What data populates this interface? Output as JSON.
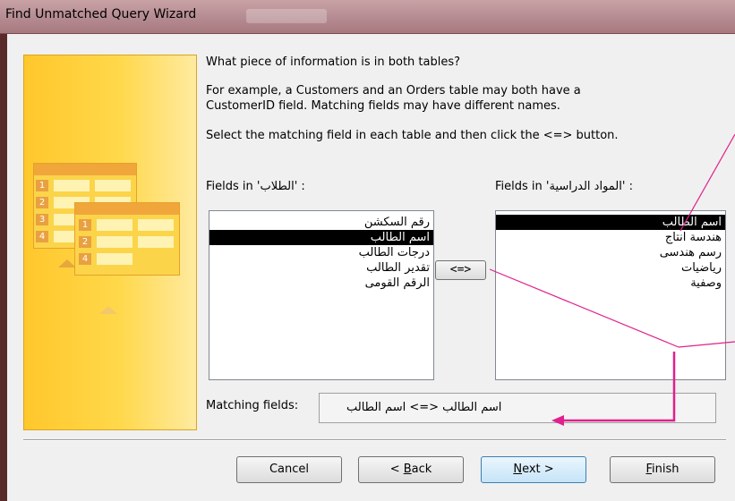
{
  "window": {
    "title": "Find Unmatched Query Wizard"
  },
  "instructions": {
    "question": "What piece of information is in both tables?",
    "example_line1": "For example, a Customers and an Orders table may both have a",
    "example_line2": "CustomerID field. Matching fields may have different names.",
    "select_hint": "Select the matching field in each table and then click the <=> button."
  },
  "left_list": {
    "label": "Fields in 'الطلاب' :",
    "items": [
      "رقم السكشن",
      "اسم الطالب",
      "درجات الطالب",
      "تقدير الطالب",
      "الرقم القومى"
    ],
    "selected_index": 1
  },
  "right_list": {
    "label": "Fields in 'المواد الدراسية' :",
    "items": [
      "اسم الطالب",
      "هندسة انتاج",
      "رسم هندسى",
      "رياضيات",
      "وصفية"
    ],
    "selected_index": 0
  },
  "match_button_label": "<=>",
  "matching": {
    "label": "Matching fields:",
    "value": "اسم الطالب <=> اسم الطالب"
  },
  "buttons": {
    "cancel": "Cancel",
    "back_prefix": "< ",
    "back_key": "B",
    "back_rest": "ack",
    "next_key": "N",
    "next_rest": "ext >",
    "finish_key": "F",
    "finish_rest": "inish"
  },
  "art_numbers": {
    "back_table": [
      "1",
      "2",
      "3",
      "4"
    ],
    "front_table": [
      "1",
      "2",
      "4"
    ]
  },
  "colors": {
    "annotation": "#e0208c",
    "selection": "#000000",
    "art_yellow": "#ffc72c"
  }
}
